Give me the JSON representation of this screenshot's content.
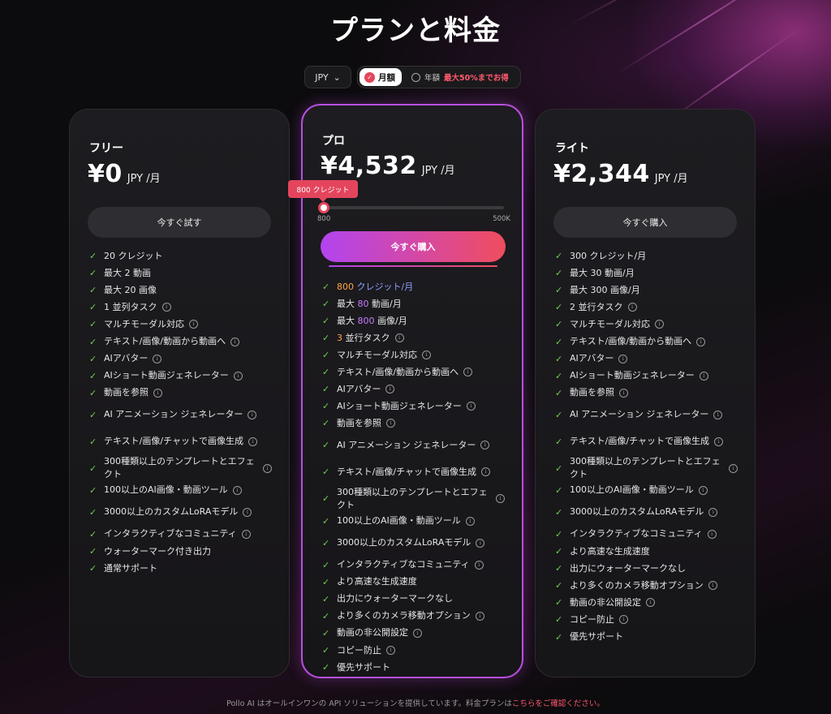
{
  "title": "プランと料金",
  "colors": {
    "accent": "#e4455d",
    "pro_border": "#b74fe0",
    "check": "#6fd04f"
  },
  "toolbar": {
    "currency": "JPY",
    "monthly_label": "月額",
    "yearly_label": "年額",
    "yearly_discount": "最大50%までお得"
  },
  "plans": {
    "free": {
      "name": "フリー",
      "price": "¥0",
      "unit": "JPY /月",
      "button": "今すぐ試す",
      "features": [
        {
          "text": "20 クレジット",
          "info": false
        },
        {
          "text": "最大 2 動画",
          "info": false
        },
        {
          "text": "最大 20 画像",
          "info": false
        },
        {
          "text": "1 並列タスク",
          "info": true
        },
        {
          "text": "マルチモーダル対応",
          "info": true
        },
        {
          "text": "テキスト/画像/動画から動画へ",
          "info": true
        },
        {
          "text": "AIアバター",
          "info": true
        },
        {
          "text": "AIショート動画ジェネレーター",
          "info": true
        },
        {
          "text": "動画を参照",
          "info": true
        },
        {
          "text": "AI アニメーション ジェネレーター",
          "info": true
        },
        {
          "text": "テキスト/画像/チャットで画像生成",
          "info": true
        },
        {
          "text": "300種類以上のテンプレートとエフェクト",
          "info": true
        },
        {
          "text": "100以上のAI画像・動画ツール",
          "info": true
        },
        {
          "text": "3000以上のカスタムLoRAモデル",
          "info": true
        },
        {
          "text": "インタラクティブなコミュニティ",
          "info": true
        },
        {
          "text": "ウォーターマーク付き出力",
          "info": false
        },
        {
          "text": "通常サポート",
          "info": false
        }
      ]
    },
    "pro": {
      "name": "プロ",
      "price": "¥4,532",
      "unit": "JPY /月",
      "button": "今すぐ購入",
      "slider": {
        "tooltip": "800 クレジット",
        "min_label": "800",
        "max_label": "500K",
        "fraction": 0.0
      },
      "credits_value": "800",
      "credits_unit": "クレジット/月",
      "videos_pre": "最大 ",
      "videos_value": "80",
      "videos_post": " 動画/月",
      "images_pre": "最大 ",
      "images_value": "800",
      "images_post": " 画像/月",
      "tasks_value": "3",
      "tasks_post": " 並行タスク",
      "features": [
        {
          "text": "マルチモーダル対応",
          "info": true
        },
        {
          "text": "テキスト/画像/動画から動画へ",
          "info": true
        },
        {
          "text": "AIアバター",
          "info": true
        },
        {
          "text": "AIショート動画ジェネレーター",
          "info": true
        },
        {
          "text": "動画を参照",
          "info": true
        },
        {
          "text": "AI アニメーション ジェネレーター",
          "info": true
        },
        {
          "text": "テキスト/画像/チャットで画像生成",
          "info": true
        },
        {
          "text": "300種類以上のテンプレートとエフェクト",
          "info": true
        },
        {
          "text": "100以上のAI画像・動画ツール",
          "info": true
        },
        {
          "text": "3000以上のカスタムLoRAモデル",
          "info": true
        },
        {
          "text": "インタラクティブなコミュニティ",
          "info": true
        },
        {
          "text": "より高速な生成速度",
          "info": false
        },
        {
          "text": "出力にウォーターマークなし",
          "info": false
        },
        {
          "text": "より多くのカメラ移動オプション",
          "info": true
        },
        {
          "text": "動画の非公開設定",
          "info": true
        },
        {
          "text": "コピー防止",
          "info": true
        },
        {
          "text": "優先サポート",
          "info": false
        }
      ]
    },
    "lite": {
      "name": "ライト",
      "price": "¥2,344",
      "unit": "JPY /月",
      "button": "今すぐ購入",
      "features": [
        {
          "text": "300 クレジット/月",
          "info": false
        },
        {
          "text": "最大 30 動画/月",
          "info": false
        },
        {
          "text": "最大 300 画像/月",
          "info": false
        },
        {
          "text": "2 並行タスク",
          "info": true
        },
        {
          "text": "マルチモーダル対応",
          "info": true
        },
        {
          "text": "テキスト/画像/動画から動画へ",
          "info": true
        },
        {
          "text": "AIアバター",
          "info": true
        },
        {
          "text": "AIショート動画ジェネレーター",
          "info": true
        },
        {
          "text": "動画を参照",
          "info": true
        },
        {
          "text": "AI アニメーション ジェネレーター",
          "info": true
        },
        {
          "text": "テキスト/画像/チャットで画像生成",
          "info": true
        },
        {
          "text": "300種類以上のテンプレートとエフェクト",
          "info": true
        },
        {
          "text": "100以上のAI画像・動画ツール",
          "info": true
        },
        {
          "text": "3000以上のカスタムLoRAモデル",
          "info": true
        },
        {
          "text": "インタラクティブなコミュニティ",
          "info": true
        },
        {
          "text": "より高速な生成速度",
          "info": false
        },
        {
          "text": "出力にウォーターマークなし",
          "info": false
        },
        {
          "text": "より多くのカメラ移動オプション",
          "info": true
        },
        {
          "text": "動画の非公開設定",
          "info": true
        },
        {
          "text": "コピー防止",
          "info": true
        },
        {
          "text": "優先サポート",
          "info": false
        }
      ]
    }
  },
  "footer": {
    "text": "Pollo AI はオールインワンの API ソリューションを提供しています。料金プランは",
    "link": "こちらをご確認ください。"
  }
}
